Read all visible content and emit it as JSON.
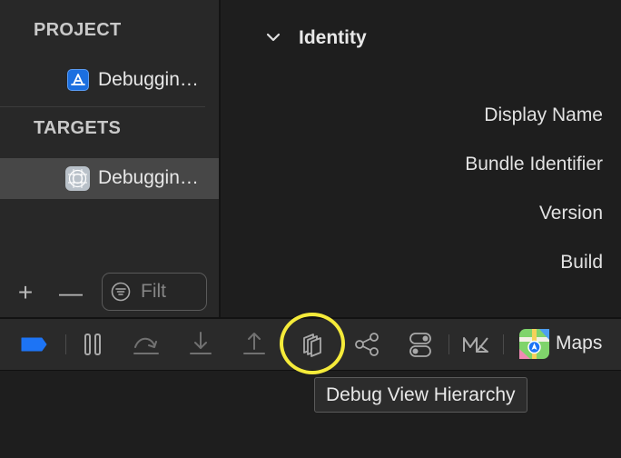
{
  "navigator": {
    "project_header": "PROJECT",
    "project_item": "Debuggin…",
    "targets_header": "TARGETS",
    "target_item": "Debuggin…",
    "add_symbol": "+",
    "remove_symbol": "—",
    "filter_placeholder": "Filt"
  },
  "inspector": {
    "section_title": "Identity",
    "fields": [
      "Display Name",
      "Bundle Identifier",
      "Version",
      "Build"
    ]
  },
  "debug_bar": {
    "location_label": "Maps",
    "tooltip": "Debug View Hierarchy",
    "icons": {
      "breakpoints": "breakpoint-icon",
      "pause": "pause-icon",
      "step_over": "step-over-icon",
      "step_into": "step-into-icon",
      "step_out": "step-out-icon",
      "view_hierarchy": "view-hierarchy-icon",
      "memory_graph": "memory-graph-icon",
      "environment_overrides": "environment-overrides-icon",
      "simulate_location": "simulate-location-icon"
    }
  },
  "colors": {
    "accent_blue": "#1d74f5",
    "highlight_ring": "#f5eb3a",
    "selection": "#474747"
  }
}
